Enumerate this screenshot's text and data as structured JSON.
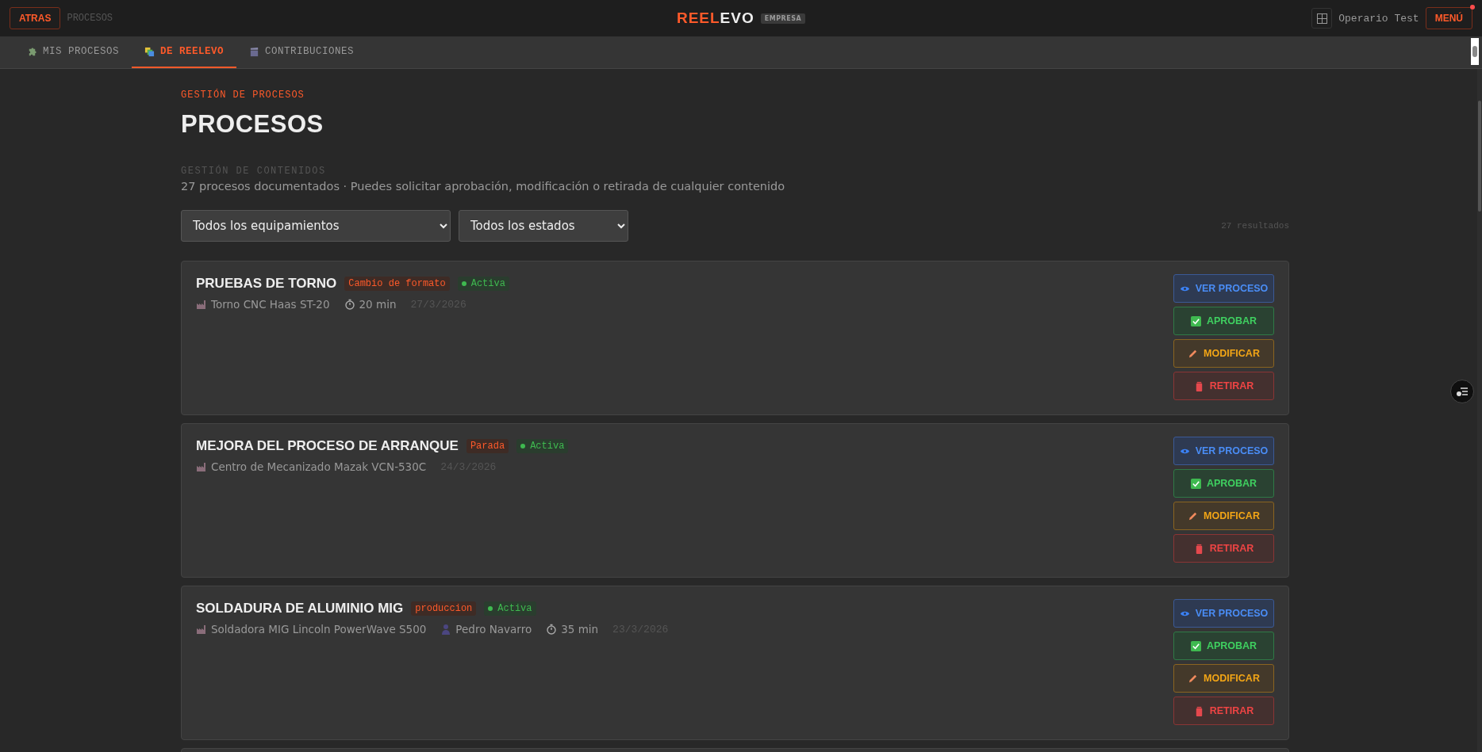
{
  "header": {
    "back_button": "ATRAS",
    "breadcrumb": "PROCESOS",
    "logo": {
      "part_1": "REEL",
      "part_2": "EVO",
      "badge": "EMPRESA"
    },
    "user": "Operario Test",
    "menu_button": "MENÚ",
    "menu_notification": true
  },
  "tabs": [
    {
      "label": "MIS PROCESOS",
      "selected": false
    },
    {
      "label": "DE REELEVO",
      "selected": true
    },
    {
      "label": "CONTRIBUCIONES",
      "selected": false
    }
  ],
  "page": {
    "eyebrow": "GESTIÓN DE PROCESOS",
    "title": "PROCESOS",
    "section_label": "GESTIÓN DE CONTENIDOS",
    "description": "27 procesos documentados · Puedes solicitar aprobación, modificación o retirada de cualquier contenido"
  },
  "filters": [
    {
      "value": "Todos los equipamientos"
    },
    {
      "value": "Todos los estados"
    }
  ],
  "result_count": "27 resultados",
  "processes": [
    {
      "title": "PRUEBAS DE TORNO",
      "category": "Cambio de formato",
      "status": "Activa",
      "meta": [
        {
          "kind": "equipment",
          "text": "Torno CNC Haas ST-20"
        },
        {
          "kind": "duration",
          "text": "20 min"
        },
        {
          "kind": "date",
          "text": "27/3/2026"
        }
      ],
      "actions": [
        {
          "kind": "view",
          "label": "VER PROCESO"
        },
        {
          "kind": "approve",
          "label": "APROBAR"
        },
        {
          "kind": "modify",
          "label": "MODIFICAR"
        },
        {
          "kind": "retire",
          "label": "RETIRAR"
        }
      ]
    },
    {
      "title": "MEJORA DEL PROCESO DE ARRANQUE",
      "category": "Parada",
      "status": "Activa",
      "meta": [
        {
          "kind": "equipment",
          "text": "Centro de Mecanizado Mazak VCN-530C"
        },
        {
          "kind": "date",
          "text": "24/3/2026"
        }
      ],
      "actions": [
        {
          "kind": "view",
          "label": "VER PROCESO"
        },
        {
          "kind": "approve",
          "label": "APROBAR"
        },
        {
          "kind": "modify",
          "label": "MODIFICAR"
        },
        {
          "kind": "retire",
          "label": "RETIRAR"
        }
      ]
    },
    {
      "title": "SOLDADURA DE ALUMINIO MIG",
      "category": "produccion",
      "status": "Activa",
      "meta": [
        {
          "kind": "equipment",
          "text": "Soldadora MIG Lincoln PowerWave S500"
        },
        {
          "kind": "person",
          "text": "Pedro Navarro"
        },
        {
          "kind": "duration",
          "text": "35 min"
        },
        {
          "kind": "date",
          "text": "23/3/2026"
        }
      ],
      "actions": [
        {
          "kind": "view",
          "label": "VER PROCESO"
        },
        {
          "kind": "approve",
          "label": "APROBAR"
        },
        {
          "kind": "modify",
          "label": "MODIFICAR"
        },
        {
          "kind": "retire",
          "label": "RETIRAR"
        }
      ]
    }
  ]
}
